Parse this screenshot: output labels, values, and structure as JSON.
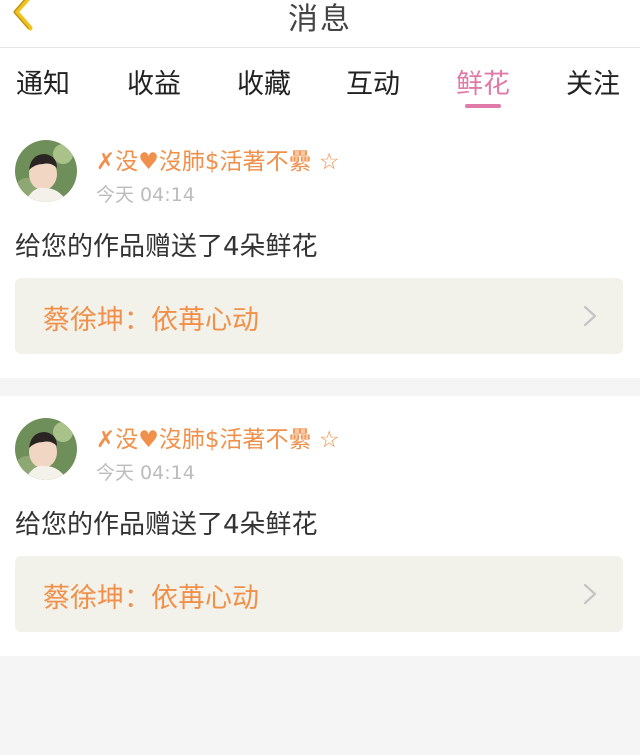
{
  "header": {
    "title": "消息",
    "back_icon": "chevron-left-icon"
  },
  "tabs": [
    {
      "label": "通知",
      "active": false
    },
    {
      "label": "收益",
      "active": false
    },
    {
      "label": "收藏",
      "active": false
    },
    {
      "label": "互动",
      "active": false
    },
    {
      "label": "鲜花",
      "active": true
    },
    {
      "label": "关注",
      "active": false
    }
  ],
  "colors": {
    "accent_pink": "#e07aa8",
    "orange": "#f0904a",
    "link_bg": "#f3f2ea"
  },
  "notifications": [
    {
      "username": "✗没♥沒肺$活著不纍 ☆",
      "time": "今天 04:14",
      "message": "给您的作品赠送了4朵鲜花",
      "work_title": "蔡徐坤：依苒心动"
    },
    {
      "username": "✗没♥沒肺$活著不纍 ☆",
      "time": "今天 04:14",
      "message": "给您的作品赠送了4朵鲜花",
      "work_title": "蔡徐坤：依苒心动"
    }
  ]
}
